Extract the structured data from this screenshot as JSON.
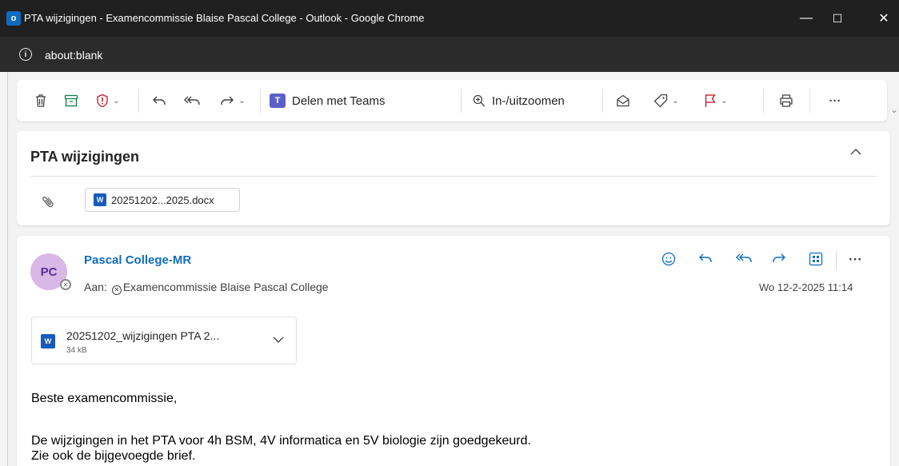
{
  "window": {
    "title": "PTA wijzigingen - Examencommissie Blaise Pascal College - Outlook - Google Chrome",
    "controls": {
      "minimize": "—",
      "maximize": "☐",
      "close": "✕"
    }
  },
  "address": {
    "url": "about:blank"
  },
  "toolbar": {
    "share_teams": "Delen met Teams",
    "zoom": "In-/uitzoomen",
    "more": "···"
  },
  "message": {
    "subject": "PTA wijzigingen",
    "header_attachment": "20251202...2025.docx",
    "sender_initials": "PC",
    "sender_name": "Pascal College-MR",
    "to_label": "Aan:",
    "to_recipient": "Examencommissie Blaise Pascal College",
    "date": "Wo 12-2-2025 11:14",
    "attachment": {
      "name": "20251202_wijzigingen PTA 2...",
      "size": "34 kB"
    },
    "body": [
      "Beste examencommissie,",
      "De wijzigingen in het PTA voor 4h BSM, 4V informatica en 5V biologie zijn goedgekeurd.",
      "Zie ook de bijgevoegde brief."
    ]
  },
  "icons": {
    "app": "outlook-icon",
    "info": "info-icon",
    "delete": "trash-icon",
    "archive": "archive-icon",
    "report": "shield-icon",
    "reply": "reply-icon",
    "reply_all": "reply-all-icon",
    "forward": "forward-icon",
    "teams": "teams-icon",
    "zoom": "zoom-icon",
    "read": "envelope-open-icon",
    "categorize": "tag-icon",
    "flag": "flag-icon",
    "print": "print-icon",
    "attachment": "paperclip-icon",
    "word": "word-icon",
    "emoji": "emoji-icon",
    "apps": "apps-icon"
  },
  "colors": {
    "titlebar": "#202020",
    "accent": "#0f6cbd",
    "avatar_bg": "#d9b8e8",
    "report_red": "#c50f1f",
    "teams": "#5b5fc7"
  }
}
